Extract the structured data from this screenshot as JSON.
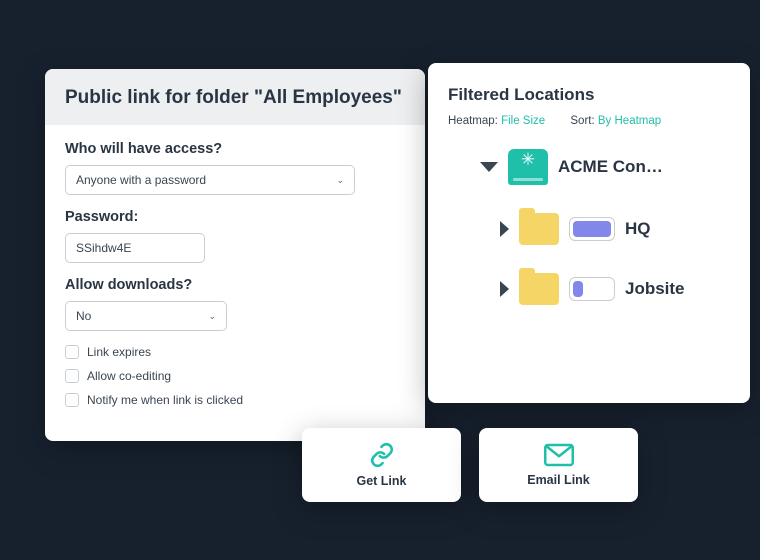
{
  "modal": {
    "title": "Public link for folder \"All Employees\"",
    "access_label": "Who will have access?",
    "access_value": "Anyone with a password",
    "password_label": "Password:",
    "password_value": "SSihdw4E",
    "downloads_label": "Allow downloads?",
    "downloads_value": "No",
    "checks": {
      "expires": "Link expires",
      "coedit": "Allow co-editing",
      "notify": "Notify me when link is clicked"
    }
  },
  "panel": {
    "title": "Filtered Locations",
    "heatmap_label": "Heatmap:",
    "heatmap_value": "File Size",
    "sort_label": "Sort:",
    "sort_value": "By Heatmap",
    "items": {
      "root": "ACME Con…",
      "hq": "HQ",
      "jobsite": "Jobsite"
    }
  },
  "actions": {
    "get_link": "Get Link",
    "email_link": "Email Link"
  }
}
